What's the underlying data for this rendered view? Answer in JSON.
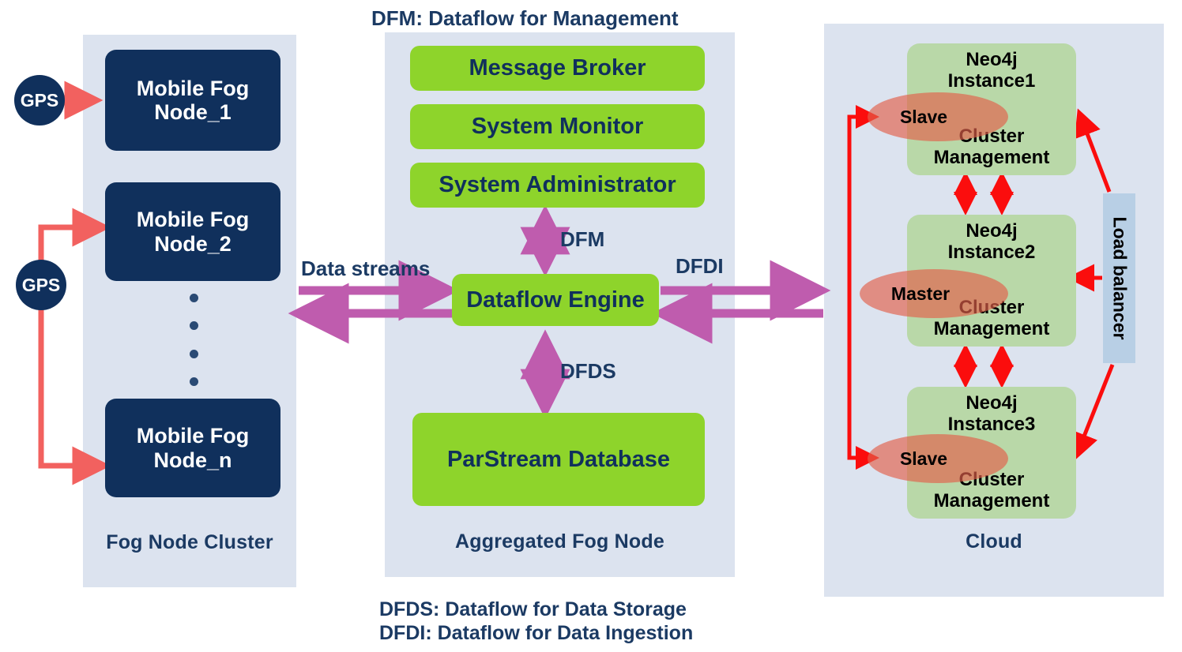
{
  "diagram": {
    "title_top": "DFM: Dataflow for Management",
    "legend": [
      "DFDS: Dataflow for Data Storage",
      "DFDI: Dataflow for Data Ingestion"
    ]
  },
  "fog_cluster": {
    "label": "Fog Node Cluster",
    "nodes": [
      {
        "line1": "Mobile Fog",
        "line2": "Node_1"
      },
      {
        "line1": "Mobile Fog",
        "line2": "Node_2"
      },
      {
        "line1": "Mobile Fog",
        "line2": "Node_n"
      }
    ],
    "sensors": [
      {
        "label": "GPS"
      },
      {
        "label": "GPS"
      }
    ]
  },
  "aggregated_fog_node": {
    "label": "Aggregated Fog Node",
    "components": [
      {
        "label": "Message Broker"
      },
      {
        "label": "System Monitor"
      },
      {
        "label": "System Administrator"
      },
      {
        "label": "Dataflow Engine"
      },
      {
        "label": "ParStream Database"
      }
    ]
  },
  "cloud": {
    "label": "Cloud",
    "instances": [
      {
        "name_line1": "Neo4j",
        "name_line2": "Instance1",
        "role": "Slave",
        "service_line1": "Cluster",
        "service_line2": "Management"
      },
      {
        "name_line1": "Neo4j",
        "name_line2": "Instance2",
        "role": "Master",
        "service_line1": "Cluster",
        "service_line2": "Management"
      },
      {
        "name_line1": "Neo4j",
        "name_line2": "Instance3",
        "role": "Slave",
        "service_line1": "Cluster",
        "service_line2": "Management"
      }
    ],
    "load_balancer": {
      "label": "Load balancer"
    }
  },
  "flows": {
    "data_streams": "Data streams",
    "dfm": "DFM",
    "dfds": "DFDS",
    "dfdi": "DFDI"
  },
  "colors": {
    "panel_bg": "#dce3ef",
    "fog_node": "#10305c",
    "green_component": "#8ed42b",
    "neo4j_box": "#b9d8a8",
    "role_ellipse": "#e2604a",
    "load_balancer": "#b8cfe5",
    "purple_arrow": "#bf5cae",
    "red_arrow": "#fb0d0d",
    "salmon_arrow": "#f2615f",
    "text_navy": "#1b3a63"
  }
}
